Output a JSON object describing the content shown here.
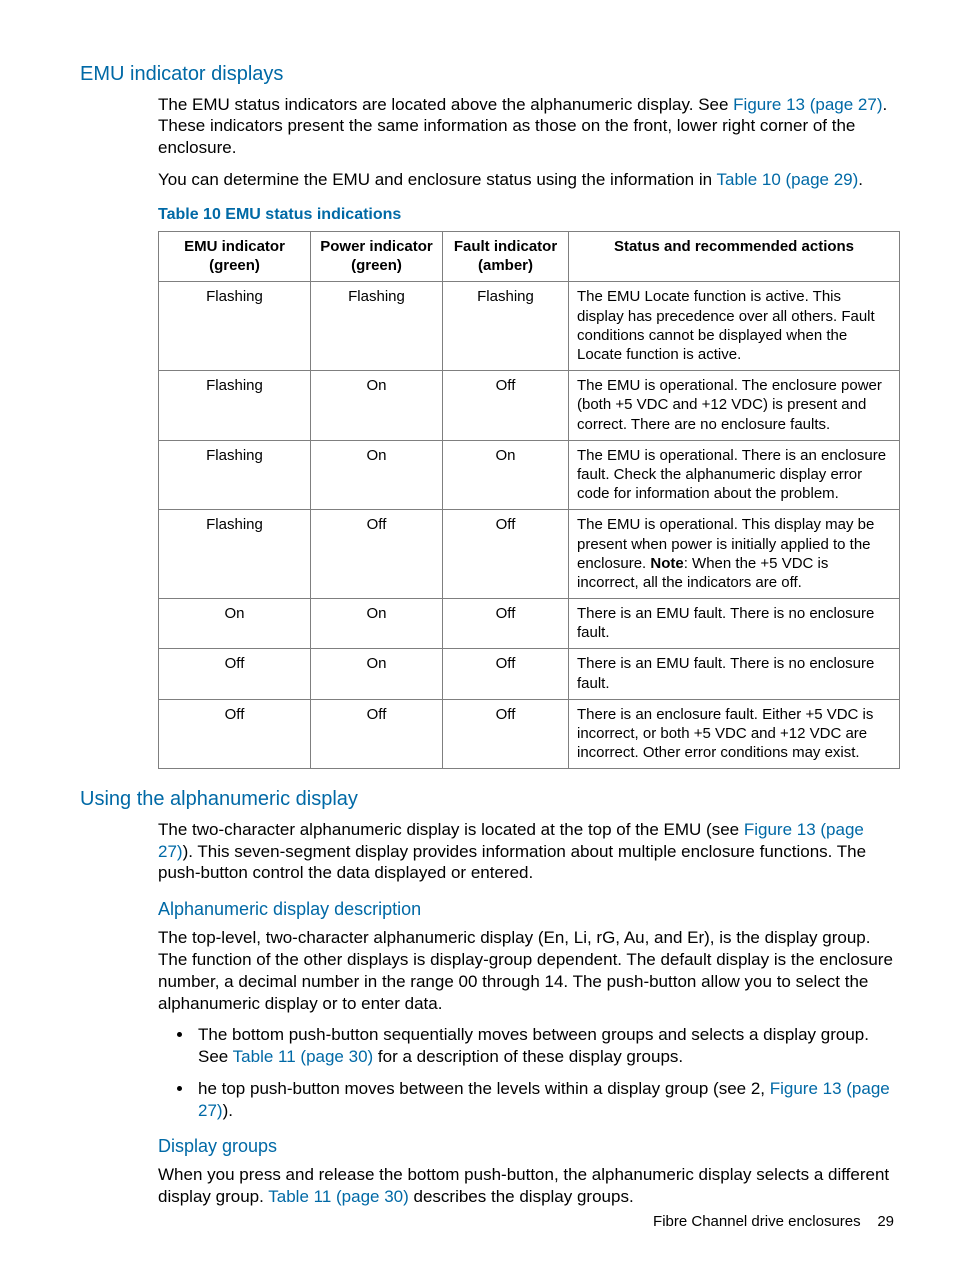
{
  "sections": {
    "emu_indicator": {
      "heading": "EMU indicator displays",
      "p1_a": "The EMU status indicators are located above the alphanumeric display. See ",
      "p1_link": "Figure 13 (page 27)",
      "p1_b": ". These indicators present the same information as those on the front, lower right corner of the enclosure.",
      "p2_a": "You can determine the EMU and enclosure status using the information in ",
      "p2_link": "Table 10 (page 29)",
      "p2_b": "."
    },
    "table10": {
      "caption": "Table 10 EMU status indications",
      "headers": [
        "EMU indicator (green)",
        "Power indicator (green)",
        "Fault indicator (amber)",
        "Status and recommended actions"
      ],
      "rows": [
        {
          "c1": "Flashing",
          "c2": "Flashing",
          "c3": "Flashing",
          "c4": "The EMU Locate function is active. This display has precedence over all others. Fault conditions cannot be displayed when the Locate function is active."
        },
        {
          "c1": "Flashing",
          "c2": "On",
          "c3": "Off",
          "c4": "The EMU is operational. The enclosure power (both +5 VDC and +12 VDC) is present and correct. There are no enclosure faults."
        },
        {
          "c1": "Flashing",
          "c2": "On",
          "c3": "On",
          "c4": "The EMU is operational. There is an enclosure fault. Check the alphanumeric display error code for information about the problem."
        },
        {
          "c1": "Flashing",
          "c2": "Off",
          "c3": "Off",
          "c4_pre": "The EMU is operational. This display may be present when power is initially applied to the enclosure. ",
          "c4_bold": "Note",
          "c4_post": ": When the +5 VDC is incorrect, all the indicators are off."
        },
        {
          "c1": "On",
          "c2": "On",
          "c3": "Off",
          "c4": "There is an EMU fault. There is no enclosure fault."
        },
        {
          "c1": "Off",
          "c2": "On",
          "c3": "Off",
          "c4": "There is an EMU fault. There is no enclosure fault."
        },
        {
          "c1": "Off",
          "c2": "Off",
          "c3": "Off",
          "c4": "There is an enclosure fault. Either +5 VDC is incorrect, or both +5 VDC and +12 VDC are incorrect. Other error conditions may exist."
        }
      ]
    },
    "using_alpha": {
      "heading": "Using the alphanumeric display",
      "p1_a": "The two-character alphanumeric display is located at the top of the EMU (see ",
      "p1_link": "Figure 13 (page 27)",
      "p1_b": "). This seven-segment display provides information about multiple enclosure functions. The push-button control the data displayed or entered."
    },
    "alpha_desc": {
      "heading": "Alphanumeric display description",
      "p1": "The top-level, two-character alphanumeric display (En, Li, rG, Au, and Er), is the display group. The function of the other displays is display-group dependent. The default display is the enclosure number, a decimal number in the range 00 through 14. The push-button allow you to select the alphanumeric display or to enter data.",
      "li1_a": "The bottom push-button sequentially moves between groups and selects a display group.",
      "li1_b_pre": "See ",
      "li1_b_link": "Table 11 (page 30)",
      "li1_b_post": " for a description of these display groups.",
      "li2_a": "he top push-button moves between the levels within a display group (see 2, ",
      "li2_link": "Figure 13 (page 27)",
      "li2_b": ")."
    },
    "display_groups": {
      "heading": "Display groups",
      "p1_a": "When you press and release the bottom push-button, the alphanumeric display selects a different display group. ",
      "p1_link": "Table 11 (page 30)",
      "p1_b": " describes the display groups."
    }
  },
  "footer": {
    "text": "Fibre Channel drive enclosures",
    "page": "29"
  }
}
